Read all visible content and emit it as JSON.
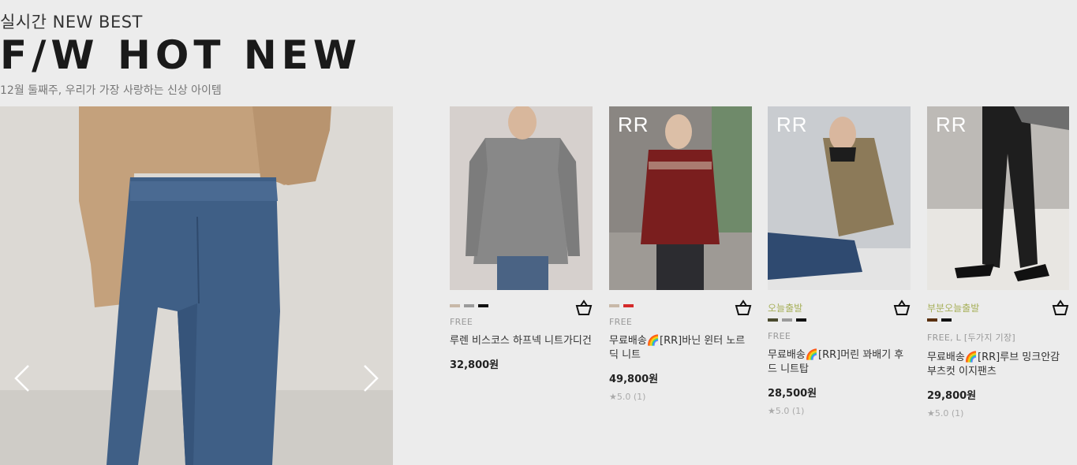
{
  "header": {
    "eyebrow": "실시간 NEW BEST",
    "title": "F/W HOT NEW",
    "subtitle": "12월 둘째주, 우리가 가장 사랑하는 신상 아이템"
  },
  "hero": {
    "prev_icon": "chevron-left-icon",
    "next_icon": "chevron-right-icon"
  },
  "products": [
    {
      "brand": "",
      "badge": "",
      "colors": [
        "#c8b8a8",
        "#9a9a9a",
        "#111111"
      ],
      "size": "FREE",
      "name": "루렌 비스코스 하프넥 니트가디건",
      "price": "32,800원",
      "review": ""
    },
    {
      "brand": "RR",
      "badge": "",
      "colors": [
        "#c8b8a8",
        "#d42a2a"
      ],
      "size": "FREE",
      "name": "무료배송🌈[RR]바닌 윈터 노르딕 니트",
      "price": "49,800원",
      "review": "★5.0 (1)"
    },
    {
      "brand": "RR",
      "badge": "오늘출발",
      "colors": [
        "#4a4a2e",
        "#9a9a9a",
        "#111111"
      ],
      "size": "FREE",
      "name": "무료배송🌈[RR]머린 꽈배기 후드 니트탑",
      "price": "28,500원",
      "review": "★5.0 (1)"
    },
    {
      "brand": "RR",
      "badge": "부분오늘출발",
      "colors": [
        "#5a3010",
        "#111111"
      ],
      "size": "FREE, L [두가지 기장]",
      "name": "무료배송🌈[RR]루브 밍크안감 부츠컷 이지팬츠",
      "price": "29,800원",
      "review": "★5.0 (1)"
    }
  ]
}
